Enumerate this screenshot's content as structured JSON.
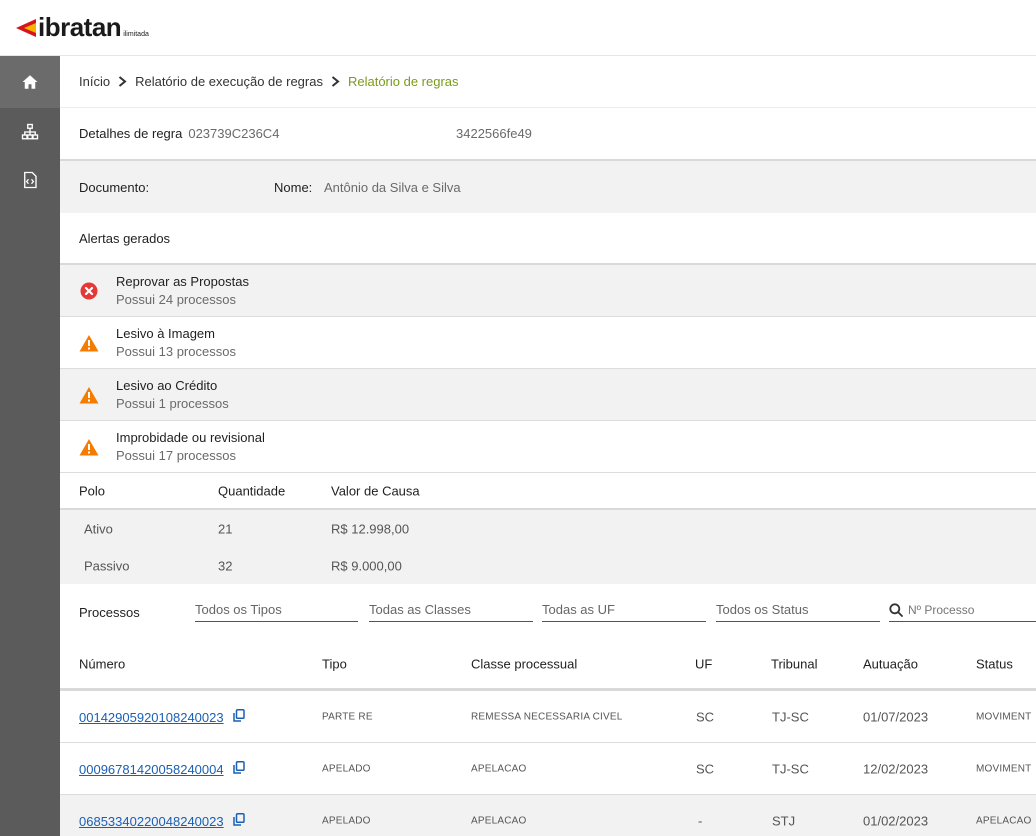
{
  "brand": {
    "logo_text": "ibratan",
    "logo_sub": "ilimitada"
  },
  "sidebar": {
    "items": [
      {
        "icon": "home-icon"
      },
      {
        "icon": "sitemap-icon"
      },
      {
        "icon": "code-file-icon"
      }
    ]
  },
  "breadcrumb": {
    "items": [
      "Início",
      "Relatório de execução de regras",
      "Relatório de regras"
    ]
  },
  "detail": {
    "label": "Detalhes de regra",
    "code": "023739C236C4",
    "hash": "3422566fe49"
  },
  "person": {
    "documento_label": "Documento:",
    "nome_label": "Nome:",
    "nome_value": "Antônio da Silva e Silva"
  },
  "alerts": {
    "title": "Alertas gerados",
    "items": [
      {
        "title": "Reprovar as Propostas",
        "sub": "Possui 24 processos",
        "severity": "error",
        "color": "#e53935"
      },
      {
        "title": "Lesivo à Imagem",
        "sub": "Possui 13 processos",
        "severity": "warning",
        "color": "#f57c00"
      },
      {
        "title": "Lesivo ao Crédito",
        "sub": "Possui 1 processos",
        "severity": "warning",
        "color": "#f57c00"
      },
      {
        "title": "Improbidade ou revisional",
        "sub": "Possui 17 processos",
        "severity": "warning",
        "color": "#f57c00"
      }
    ]
  },
  "polo": {
    "headers": [
      "Polo",
      "Quantidade",
      "Valor de Causa"
    ],
    "rows": [
      {
        "polo": "Ativo",
        "qtd": "21",
        "valor": "R$ 12.998,00"
      },
      {
        "polo": "Passivo",
        "qtd": "32",
        "valor": "R$ 9.000,00"
      }
    ]
  },
  "filters": {
    "label": "Processos",
    "tipos": "Todos os Tipos",
    "classes": "Todas as Classes",
    "ufs": "Todas as UF",
    "status": "Todos os Status",
    "search_placeholder": "Nº Processo"
  },
  "table": {
    "headers": [
      "Número",
      "Tipo",
      "Classe processual",
      "UF",
      "Tribunal",
      "Autuação",
      "Status"
    ],
    "rows": [
      {
        "numero": "00142905920108240023",
        "tipo": "PARTE RE",
        "classe": "REMESSA NECESSARIA CIVEL",
        "uf": "SC",
        "tribunal": "TJ-SC",
        "autuacao": "01/07/2023",
        "status": "MOVIMENT"
      },
      {
        "numero": "00096781420058240004",
        "tipo": "APELADO",
        "classe": "APELACAO",
        "uf": "SC",
        "tribunal": "TJ-SC",
        "autuacao": "12/02/2023",
        "status": "MOVIMENT"
      },
      {
        "numero": "06853340220048240023",
        "tipo": "APELADO",
        "classe": "APELACAO",
        "uf": "-",
        "tribunal": "STJ",
        "autuacao": "01/02/2023",
        "status": "APELACAO"
      }
    ]
  },
  "colors": {
    "accent": "#7a9b1a",
    "link": "#1a5fb4",
    "sidebar": "#5b5b5b"
  }
}
